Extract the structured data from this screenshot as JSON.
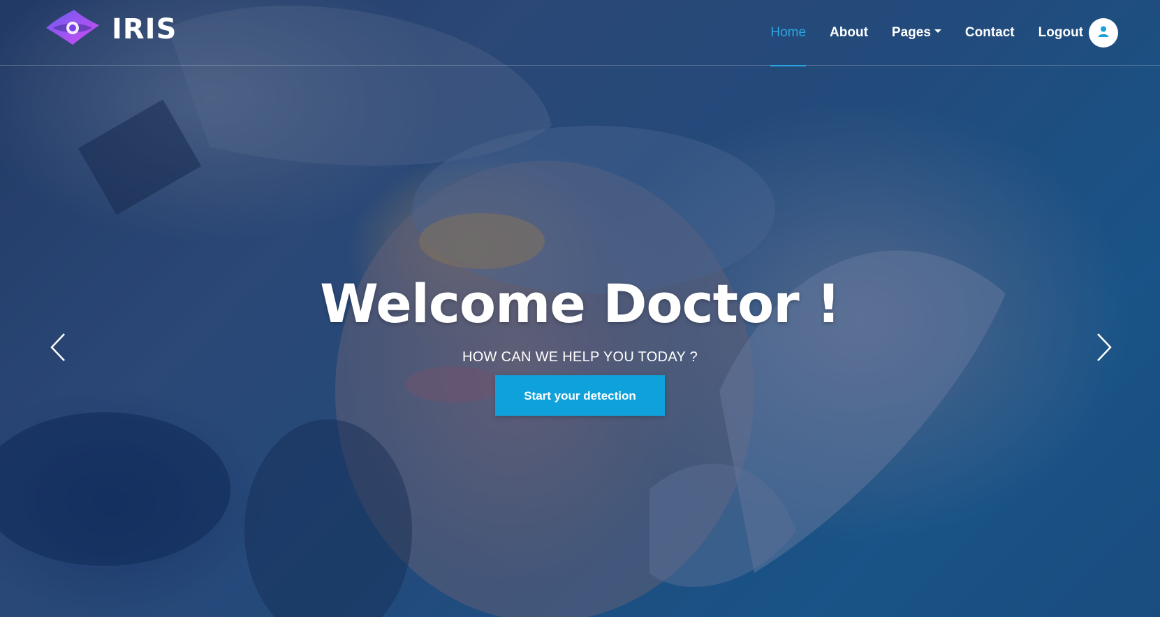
{
  "brand": {
    "name": "IRIS",
    "logo_icon": "eye-logo-icon"
  },
  "nav": {
    "items": [
      {
        "label": "Home",
        "active": true
      },
      {
        "label": "About"
      },
      {
        "label": "Pages",
        "has_dropdown": true
      },
      {
        "label": "Contact"
      },
      {
        "label": "Logout"
      }
    ],
    "user_icon": "user-icon"
  },
  "hero": {
    "title": "Welcome Doctor !",
    "subtitle": "HOW CAN WE HELP YOU TODAY ?",
    "cta_label": "Start your detection",
    "prev_icon": "chevron-left-icon",
    "next_icon": "chevron-right-icon"
  },
  "colors": {
    "accent": "#0fa1dc",
    "active_link": "#2aa7e2",
    "overlay": "#123060"
  }
}
